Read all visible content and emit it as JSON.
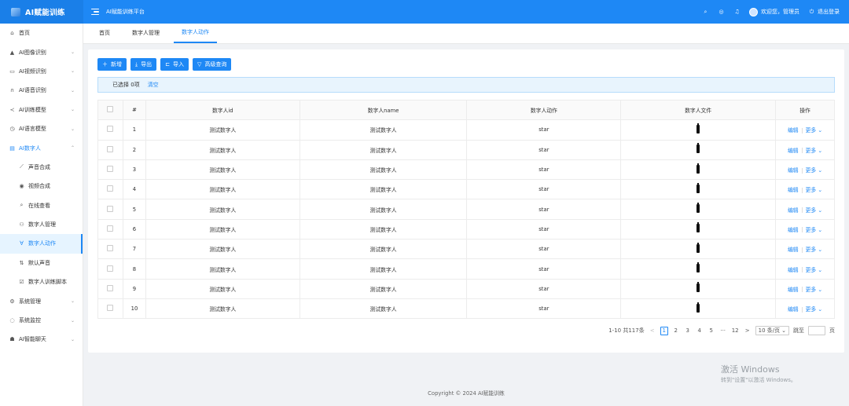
{
  "app": {
    "title": "AI赋能训练",
    "platform": "AI赋能训练平台"
  },
  "header": {
    "welcome": "欢迎您，管理员",
    "logout": "退出登录",
    "icons": [
      "search-icon",
      "help-icon",
      "bell-icon",
      "avatar",
      "logout-icon"
    ]
  },
  "sidebar": {
    "items": [
      {
        "label": "首页",
        "icon": "⌂",
        "arrow": ""
      },
      {
        "label": "AI图像识别",
        "icon": "▲",
        "arrow": "⌄"
      },
      {
        "label": "AI视频识别",
        "icon": "▭",
        "arrow": "⌄"
      },
      {
        "label": "AI语音识别",
        "icon": "∩",
        "arrow": "⌄"
      },
      {
        "label": "AI训练模型",
        "icon": "≺",
        "arrow": "⌄"
      },
      {
        "label": "AI语言模型",
        "icon": "◷",
        "arrow": "⌄"
      },
      {
        "label": "AI数字人",
        "icon": "▤",
        "arrow": "⌃"
      }
    ],
    "subitems": [
      {
        "label": "声音合成",
        "icon": "⟋"
      },
      {
        "label": "视频合成",
        "icon": "◉"
      },
      {
        "label": "在线查看",
        "icon": "⌕"
      },
      {
        "label": "数字人管理",
        "icon": "⚇"
      },
      {
        "label": "数字人动作",
        "icon": "∀"
      },
      {
        "label": "默认声音",
        "icon": "⇅"
      },
      {
        "label": "数字人训练脚本",
        "icon": "☑"
      }
    ],
    "bottom": [
      {
        "label": "系统管理",
        "icon": "⚙",
        "arrow": "⌄"
      },
      {
        "label": "系统监控",
        "icon": "◌",
        "arrow": "⌄"
      },
      {
        "label": "AI智能聊天",
        "icon": "☗",
        "arrow": "⌄"
      }
    ]
  },
  "tabs": [
    "首页",
    "数字人管理",
    "数字人动作"
  ],
  "toolbar": {
    "add": "新增",
    "export": "导出",
    "import": "导入",
    "advanced": "高级查询"
  },
  "selection": {
    "text": "已选择 0项",
    "clear": "清空"
  },
  "table": {
    "headers": [
      "#",
      "数字人id",
      "数字人name",
      "数字人动作",
      "数字人文件",
      "操作"
    ],
    "rows": [
      {
        "n": "1",
        "id": "测试数字人",
        "name": "测试数字人",
        "action": "star"
      },
      {
        "n": "2",
        "id": "测试数字人",
        "name": "测试数字人",
        "action": "star"
      },
      {
        "n": "3",
        "id": "测试数字人",
        "name": "测试数字人",
        "action": "star"
      },
      {
        "n": "4",
        "id": "测试数字人",
        "name": "测试数字人",
        "action": "star"
      },
      {
        "n": "5",
        "id": "测试数字人",
        "name": "测试数字人",
        "action": "star"
      },
      {
        "n": "6",
        "id": "测试数字人",
        "name": "测试数字人",
        "action": "star"
      },
      {
        "n": "7",
        "id": "测试数字人",
        "name": "测试数字人",
        "action": "star"
      },
      {
        "n": "8",
        "id": "测试数字人",
        "name": "测试数字人",
        "action": "star"
      },
      {
        "n": "9",
        "id": "测试数字人",
        "name": "测试数字人",
        "action": "star"
      },
      {
        "n": "10",
        "id": "测试数字人",
        "name": "测试数字人",
        "action": "star"
      }
    ],
    "edit": "编辑",
    "more": "更多"
  },
  "pagination": {
    "summary": "1-10 共117条",
    "pages": [
      "1",
      "2",
      "3",
      "4",
      "5"
    ],
    "ellipsis": "···",
    "last": "12",
    "prev": "<",
    "next": ">",
    "size": "10 条/页",
    "goto": "跳至",
    "page_unit": "页"
  },
  "watermark": {
    "line1": "激活 Windows",
    "line2": "转到\"设置\"以激活 Windows。"
  },
  "footer": "Copyright © 2024 AI赋能训练",
  "colors": {
    "primary": "#1e88f5",
    "header": "#1e88f5",
    "alert_bg": "#e8f4fd"
  }
}
